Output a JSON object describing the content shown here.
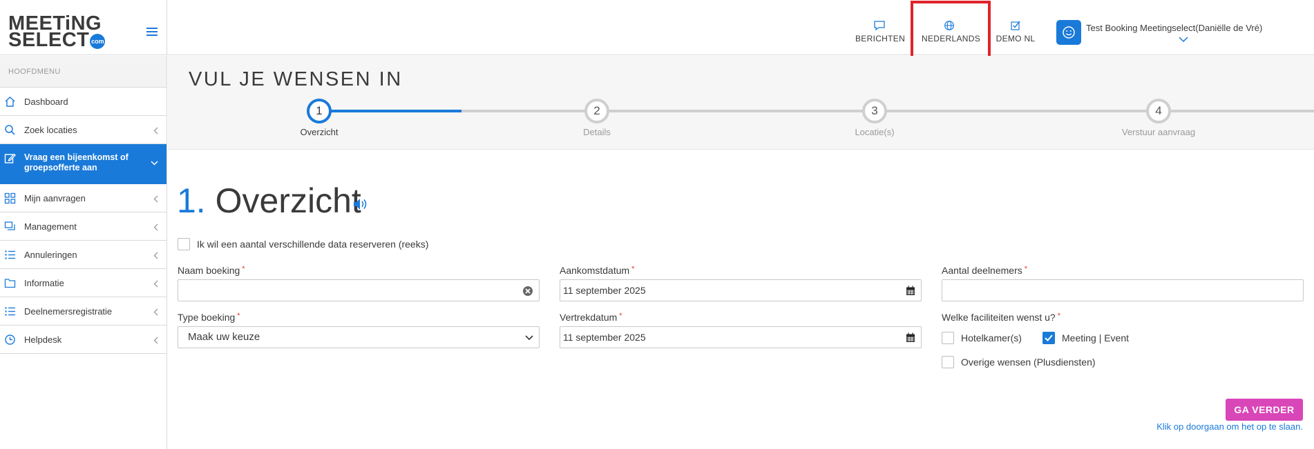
{
  "header": {
    "logo_line1": "MEETiNG",
    "logo_line2": "SELECT",
    "logo_badge": "com",
    "nav": [
      {
        "label": "BERICHTEN",
        "icon": "chat-icon"
      },
      {
        "label": "NEDERLANDS",
        "icon": "globe-icon"
      },
      {
        "label": "DEMO NL",
        "icon": "checkbox-icon"
      }
    ],
    "user_name": "Test Booking Meetingselect(Daniëlle de Vré)",
    "highlight_color": "#e0232a"
  },
  "sidebar": {
    "heading": "HOOFDMENU",
    "items": [
      {
        "label": "Dashboard",
        "icon": "home-icon"
      },
      {
        "label": "Zoek locaties",
        "icon": "search-icon"
      },
      {
        "label": "Vraag een bijeenkomst of groepsofferte aan",
        "icon": "edit-icon"
      },
      {
        "label": "Mijn aanvragen",
        "icon": "grid-icon"
      },
      {
        "label": "Management",
        "icon": "layers-icon"
      },
      {
        "label": "Annuleringen",
        "icon": "list-icon"
      },
      {
        "label": "Informatie",
        "icon": "folder-icon"
      },
      {
        "label": "Deelnemersregistratie",
        "icon": "list-icon"
      },
      {
        "label": "Helpdesk",
        "icon": "clock-icon"
      }
    ]
  },
  "wizard": {
    "title": "VUL JE WENSEN IN",
    "steps": [
      {
        "num": "1",
        "label": "Overzicht"
      },
      {
        "num": "2",
        "label": "Details"
      },
      {
        "num": "3",
        "label": "Locatie(s)"
      },
      {
        "num": "4",
        "label": "Verstuur aanvraag"
      }
    ],
    "active_step": 1
  },
  "form": {
    "section_num": "1.",
    "section_title": "Overzicht",
    "series_checkbox": "Ik wil een aantal verschillende data reserveren (reeks)",
    "naam_label": "Naam boeking",
    "naam_value": "",
    "aankomst_label": "Aankomstdatum",
    "aankomst_value": "11 september 2025",
    "deelnemers_label": "Aantal deelnemers",
    "deelnemers_value": "",
    "type_label": "Type boeking",
    "type_value": "Maak uw keuze",
    "vertrek_label": "Vertrekdatum",
    "vertrek_value": "11 september 2025",
    "faciliteiten_label": "Welke faciliteiten wenst u?",
    "facilities": [
      {
        "label": "Hotelkamer(s)",
        "checked": false
      },
      {
        "label": "Meeting | Event",
        "checked": true
      },
      {
        "label": "Overige wensen (Plusdiensten)",
        "checked": false
      }
    ],
    "required_mark": "*",
    "next_button": "GA VERDER",
    "save_hint": "Klik op doorgaan om het op te slaan."
  },
  "colors": {
    "accent": "#1a7ad9",
    "next_button": "#d946b8"
  }
}
